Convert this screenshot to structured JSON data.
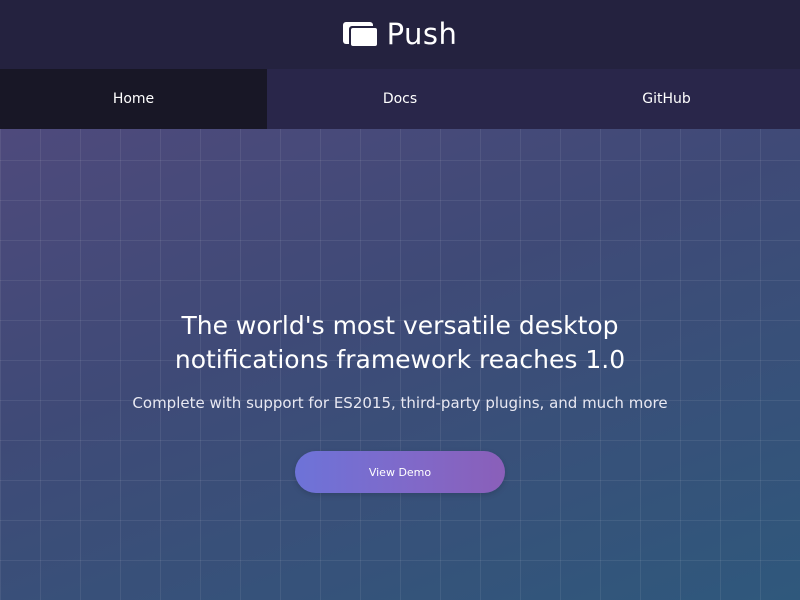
{
  "header": {
    "brand_name": "Push",
    "logo_icon": "stacked-windows-icon"
  },
  "nav": {
    "items": [
      {
        "label": "Home",
        "active": true
      },
      {
        "label": "Docs",
        "active": false
      },
      {
        "label": "GitHub",
        "active": false
      }
    ]
  },
  "hero": {
    "title_line1": "The world's most versatile desktop",
    "title_line2": "notifications framework reaches 1.0",
    "subtitle": "Complete with support for ES2015, third-party plugins, and much more",
    "button_label": "View Demo"
  },
  "colors": {
    "header_bg": "#24223f",
    "nav_bg": "#29264a",
    "nav_active_bg": "#181726",
    "hero_gradient_start": "#4e4a7c",
    "hero_gradient_end": "#2f587c",
    "button_gradient_start": "#6d73d8",
    "button_gradient_end": "#8a5fb9"
  }
}
